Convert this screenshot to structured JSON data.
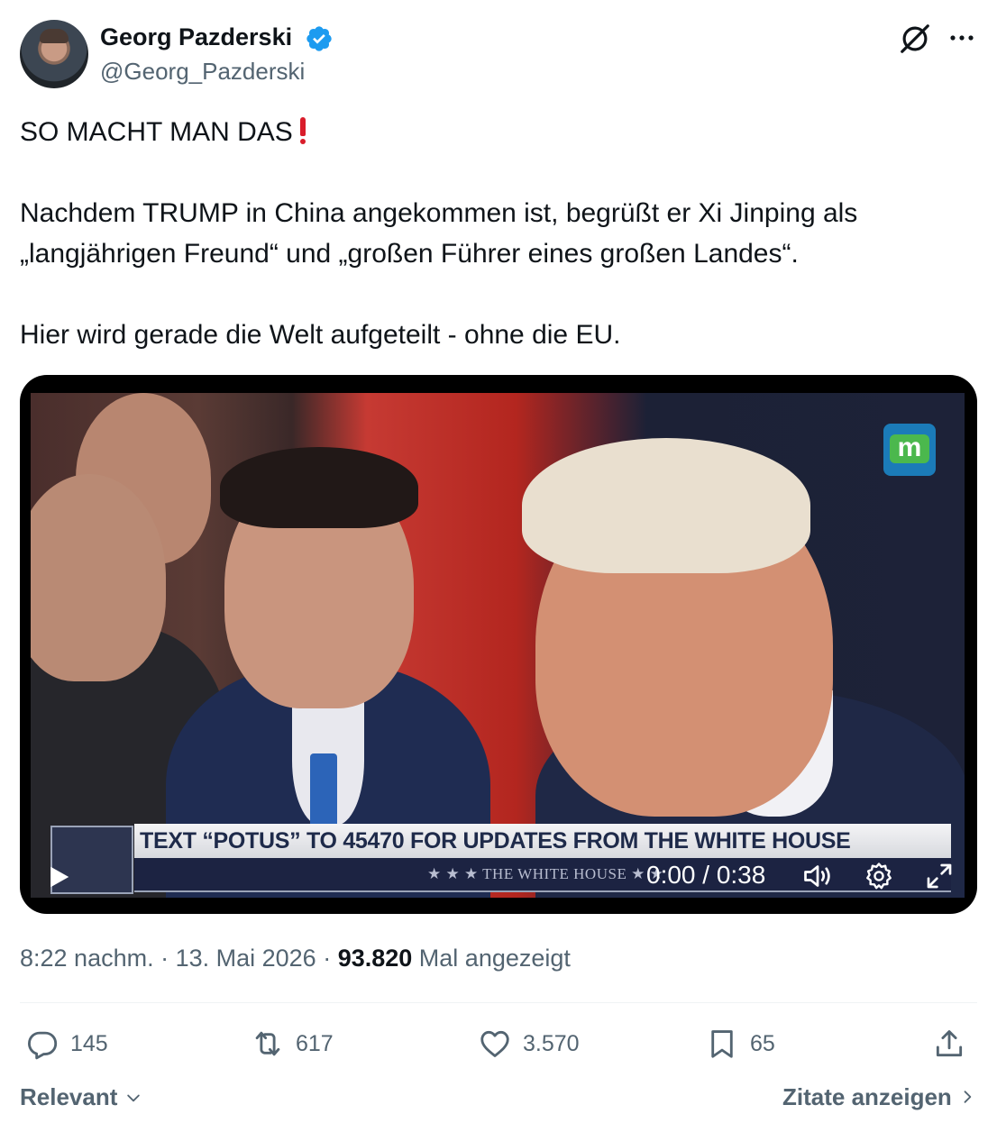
{
  "author": {
    "display_name": "Georg Pazderski",
    "handle": "@Georg_Pazderski",
    "verified": true
  },
  "tweet": {
    "line1": "SO MACHT MAN DAS",
    "line2": "Nachdem TRUMP in China angekommen ist, begrüßt er Xi Jinping als",
    "line3": "„langjährigen Freund“ und „großen Führer eines großen Landes“.",
    "line4": "Hier wird gerade die Welt aufgeteilt - ohne die EU."
  },
  "video": {
    "logo_letter": "m",
    "banner_text": "TEXT “POTUS” TO 45470 FOR UPDATES FROM THE WHITE HOUSE",
    "subbar_text": "★ ★ ★   THE WHITE HOUSE   ★ ★",
    "time": "0:00 / 0:38"
  },
  "meta": {
    "time": "8:22 nachm.",
    "sep1": " · ",
    "date": "13. Mai 2026",
    "sep2": " · ",
    "views": "93.820",
    "views_label": " Mal angezeigt"
  },
  "actions": {
    "replies": "145",
    "retweets": "617",
    "likes": "3.570",
    "bookmarks": "65"
  },
  "footer": {
    "sort_label": "Relevant",
    "quotes_label": "Zitate anzeigen"
  },
  "colors": {
    "text": "#0f1419",
    "secondary": "#536471",
    "verified": "#1d9bf0",
    "exclamation": "#d91d2b"
  },
  "icons": [
    "verified-badge-icon",
    "grok-icon",
    "more-icon",
    "play-icon",
    "volume-icon",
    "settings-icon",
    "fullscreen-icon",
    "reply-icon",
    "retweet-icon",
    "like-icon",
    "bookmark-icon",
    "share-icon",
    "chevron-down-icon",
    "chevron-right-icon"
  ]
}
